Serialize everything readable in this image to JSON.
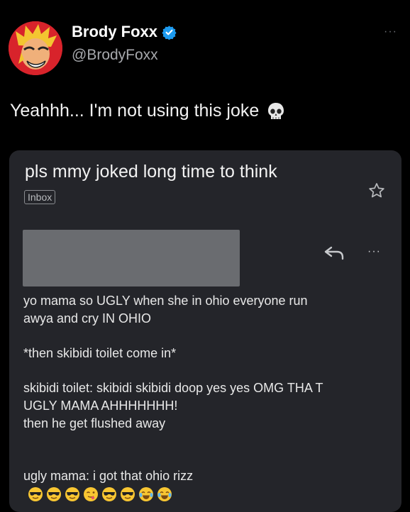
{
  "tweet": {
    "display_name": "Brody Foxx",
    "handle": "@BrodyFoxx",
    "more_label": "···",
    "text": "Yeahhh... I'm not using this joke"
  },
  "email": {
    "subject": "pls mmy joked long time to think",
    "inbox_label": "Inbox",
    "more_label": "···",
    "paragraphs": [
      "yo mama so UGLY when she in ohio  everyone run\nawya and cry IN OHIO",
      "*then skibidi toilet come in*",
      "skibidi toilet: skibidi skibidi doop yes yes OMG THA T\nUGLY MAMA  AHHHHHHH!\nthen he get flushed away",
      "ugly mama: i got that ohio rizz"
    ],
    "emojis": [
      "sunglasses-emoji",
      "sunglasses-emoji",
      "sunglasses-emoji",
      "wink-tongue-emoji",
      "sunglasses-emoji",
      "sunglasses-emoji",
      "tears-of-joy-emoji",
      "tears-of-joy-emoji"
    ]
  },
  "colors": {
    "verified": "#1d9bf0",
    "avatar_bg": "#d8232b",
    "card_bg": "#24252a"
  }
}
